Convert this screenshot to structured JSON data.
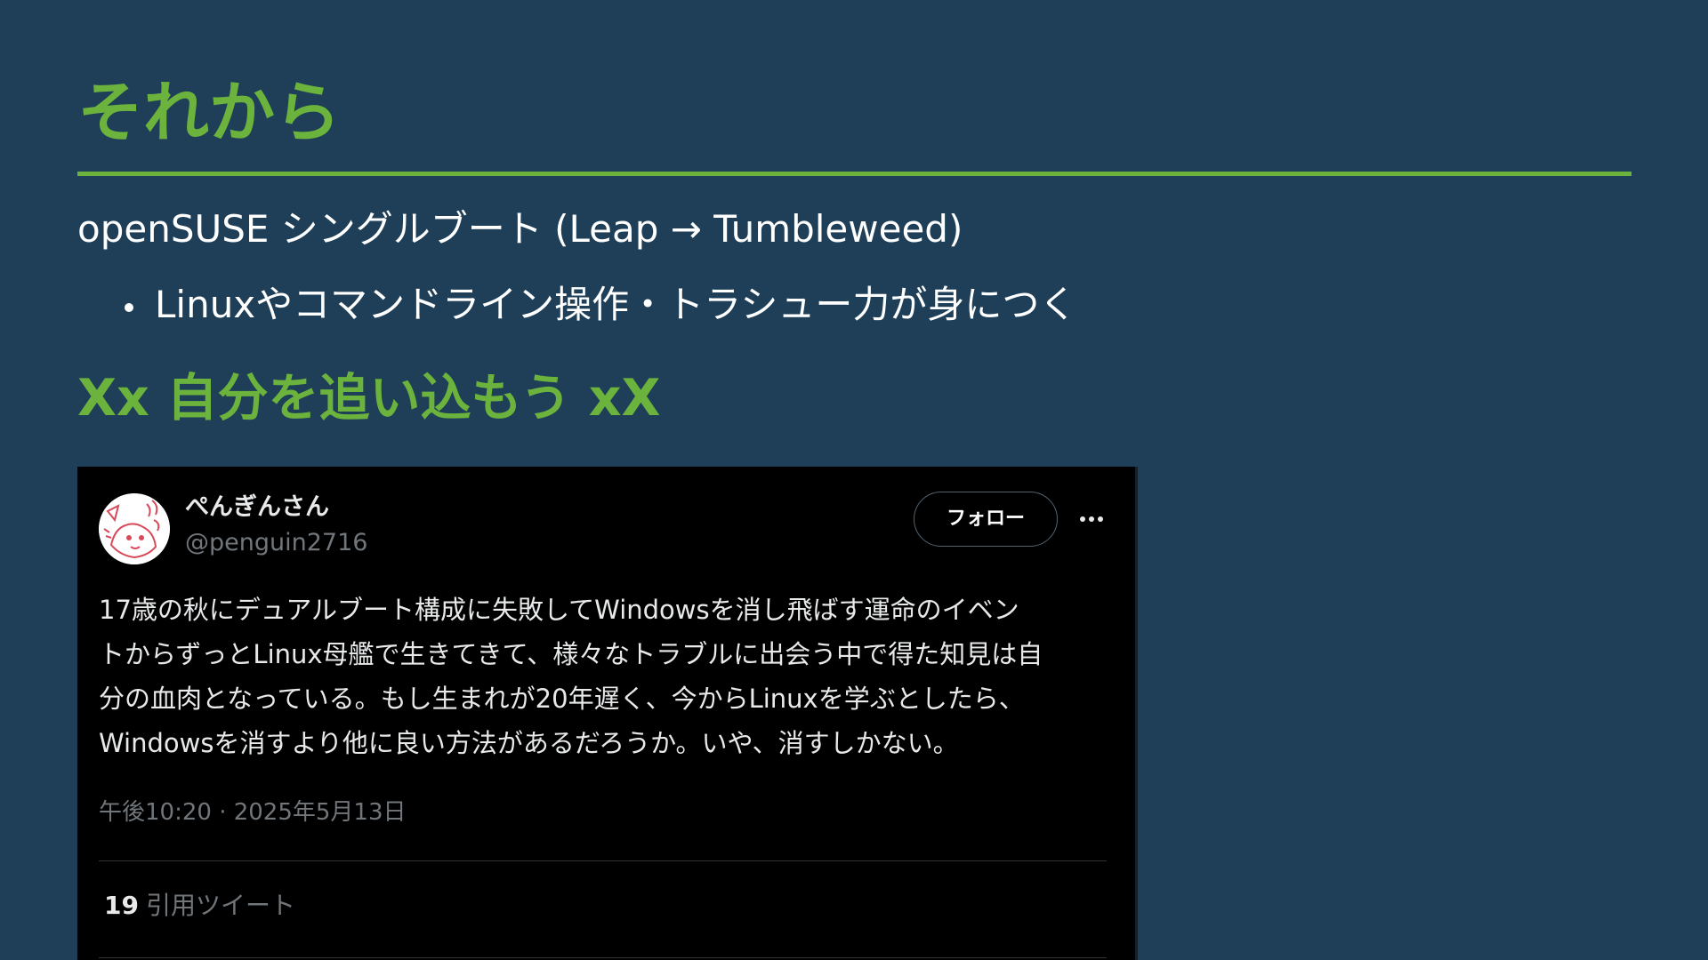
{
  "slide": {
    "title": "それから",
    "subtitle": "openSUSE シングルブート (Leap → Tumbleweed)",
    "bullets": [
      "Linuxやコマンドライン操作・トラシュー力が身につく"
    ],
    "heading2": "Xx 自分を追い込もう xX"
  },
  "tweet": {
    "author_name": "ぺんぎんさん",
    "author_handle": "@penguin2716",
    "follow_label": "フォロー",
    "more_icon": "more-horizontal-icon",
    "avatar_icon": "avatar-illustration",
    "text_lines": [
      "17歳の秋にデュアルブート構成に失敗してWindowsを消し飛ばす運命のイベン",
      "トからずっとLinux母艦で生きてきて、様々なトラブルに出会う中で得た知見は自",
      "分の血肉となっている。もし生まれが20年遅く、今からLinuxを学ぶとしたら、",
      "Windowsを消すより他に良い方法があるだろうか。いや、消すしかない。"
    ],
    "timestamp": "午後10:20 · 2025年5月13日",
    "quote_count": "19",
    "quote_label": "引用ツイート"
  },
  "colors": {
    "background": "#1e3f57",
    "accent": "#6cb33e",
    "text": "#ffffff",
    "card_background": "#000000",
    "muted_text": "#71767b"
  }
}
